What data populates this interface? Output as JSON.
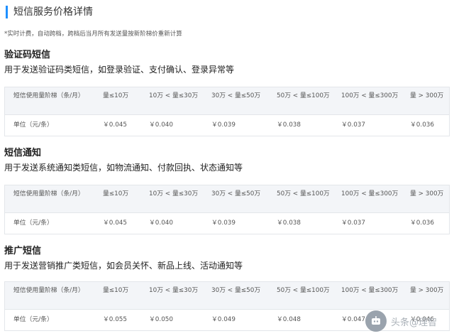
{
  "header": {
    "title": "短信服务价格详情"
  },
  "note": "*实时计费，自动跨档，跨档后当月所有发送量按新阶梯价重新计算",
  "tiers": [
    "短信使用量阶梯（条/月）",
    "量≤10万",
    "10万 < 量≤30万",
    "30万 < 量≤50万",
    "50万 < 量≤100万",
    "100万 < 量≤300万",
    "量 > 300万"
  ],
  "unit_label": "单位（元/条）",
  "sections": [
    {
      "title": "验证码短信",
      "description": "用于发送验证码类短信，如登录验证、支付确认、登录异常等",
      "prices": [
        "￥0.045",
        "￥0.040",
        "￥0.039",
        "￥0.038",
        "￥0.037",
        "￥0.036"
      ]
    },
    {
      "title": "短信通知",
      "description": "用于发送系统通知类短信，如物流通知、付款回执、状态通知等",
      "prices": [
        "￥0.045",
        "￥0.040",
        "￥0.039",
        "￥0.038",
        "￥0.037",
        "￥0.036"
      ]
    },
    {
      "title": "推广短信",
      "description": "用于发送营销推广类短信，如会员关怀、新品上线、活动通知等",
      "prices": [
        "￥0.055",
        "￥0.050",
        "￥0.049",
        "￥0.048",
        "￥0.047",
        "￥0.046"
      ]
    }
  ],
  "watermark": {
    "text": "头条@理智"
  }
}
